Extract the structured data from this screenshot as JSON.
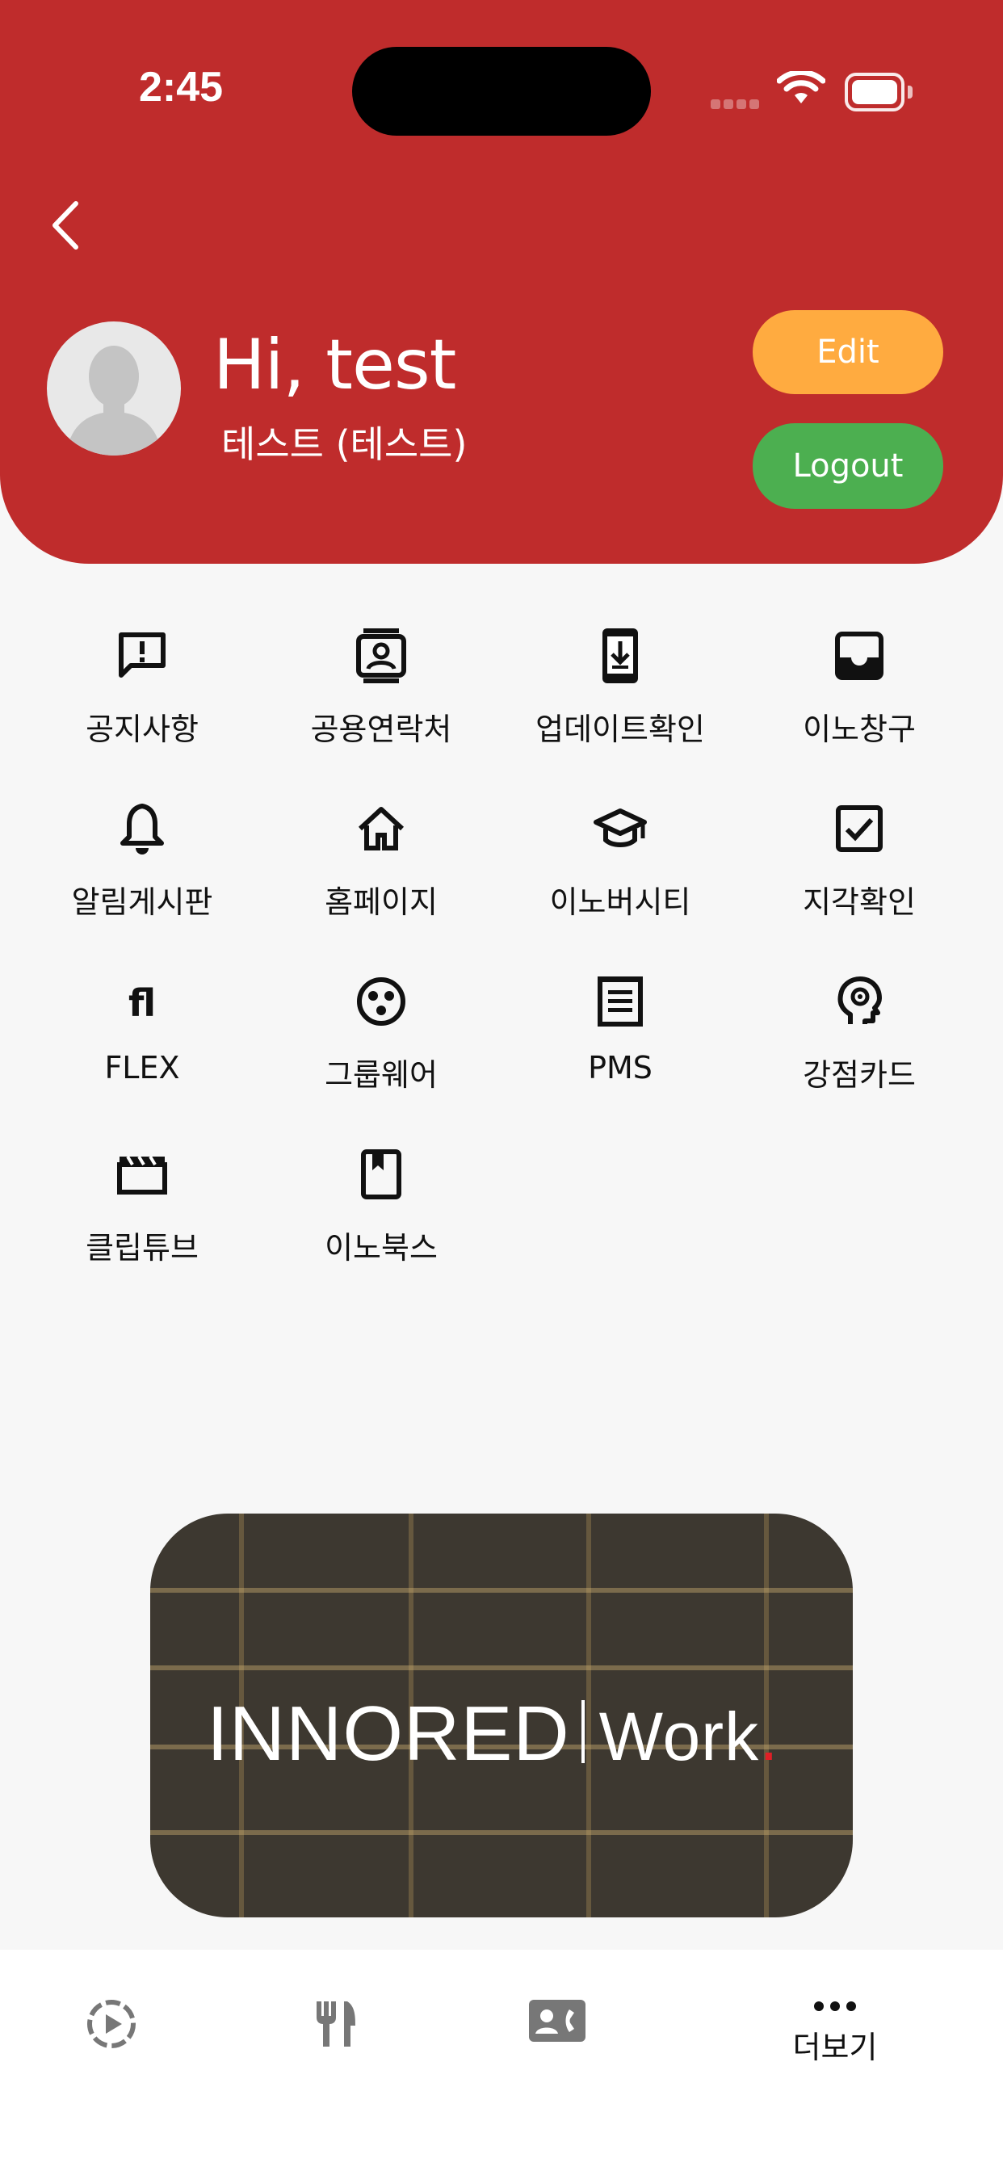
{
  "status_bar": {
    "time": "2:45"
  },
  "header": {
    "greeting": "Hi, test",
    "subname": "테스트 (테스트)",
    "edit_label": "Edit",
    "logout_label": "Logout",
    "colors": {
      "background": "#bf2c2c",
      "edit": "#ffab40",
      "logout": "#4caf50"
    }
  },
  "menu": [
    {
      "label": "공지사항",
      "icon": "announcement-icon"
    },
    {
      "label": "공용연락처",
      "icon": "contact-card-icon"
    },
    {
      "label": "업데이트확인",
      "icon": "phone-download-icon"
    },
    {
      "label": "이노창구",
      "icon": "inbox-icon"
    },
    {
      "label": "알림게시판",
      "icon": "bell-icon"
    },
    {
      "label": "홈페이지",
      "icon": "home-icon"
    },
    {
      "label": "이노버시티",
      "icon": "graduation-cap-icon"
    },
    {
      "label": "지각확인",
      "icon": "checkbox-icon"
    },
    {
      "label": "FLEX",
      "icon": "flex-logo-icon"
    },
    {
      "label": "그룹웨어",
      "icon": "groupware-icon"
    },
    {
      "label": "PMS",
      "icon": "document-list-icon"
    },
    {
      "label": "강점카드",
      "icon": "head-gear-icon"
    },
    {
      "label": "클립튜브",
      "icon": "clapperboard-icon"
    },
    {
      "label": "이노북스",
      "icon": "book-icon"
    }
  ],
  "banner": {
    "brand": "INNORED",
    "work": "Work",
    "dot": "."
  },
  "tabbar": {
    "tabs": [
      {
        "icon": "play-circle-icon",
        "label": ""
      },
      {
        "icon": "utensils-icon",
        "label": ""
      },
      {
        "icon": "contact-call-icon",
        "label": ""
      },
      {
        "icon": "more-dots-icon",
        "label": "더보기"
      }
    ]
  }
}
